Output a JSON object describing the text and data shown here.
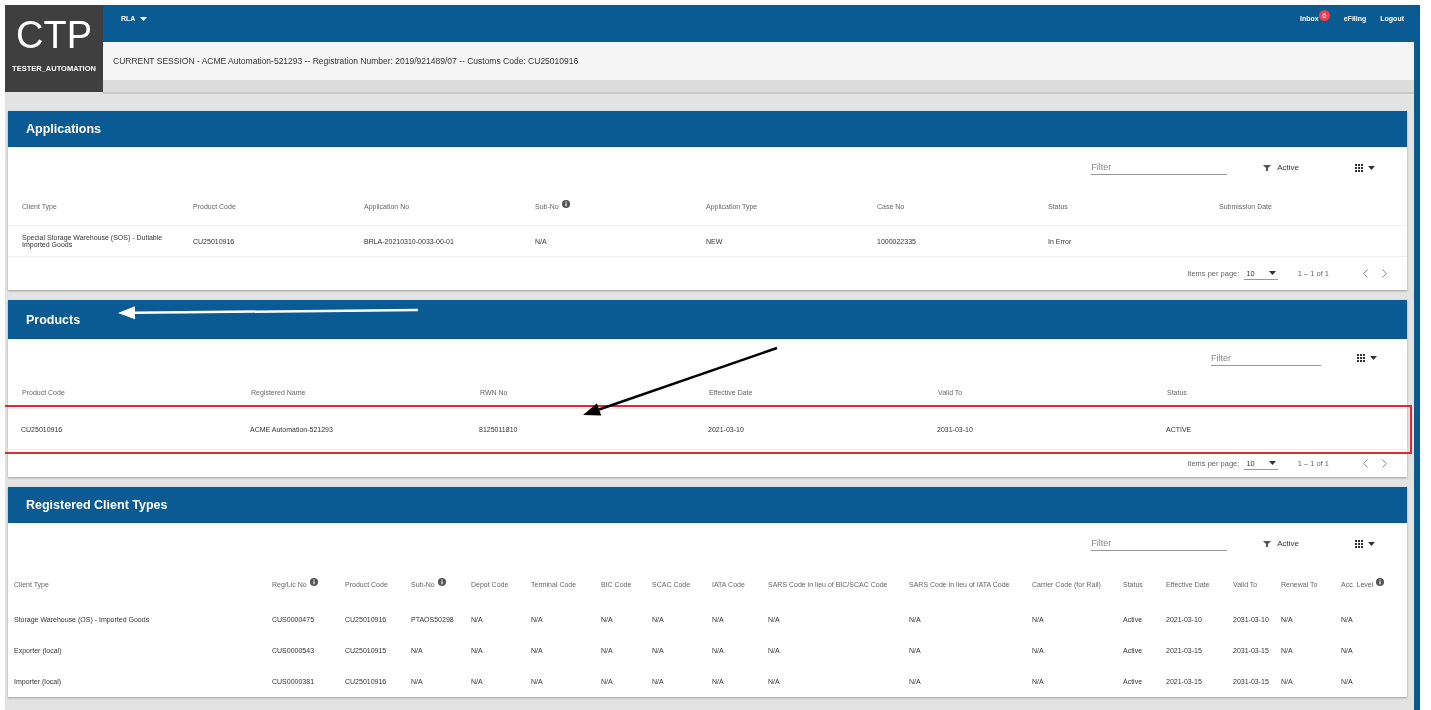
{
  "logo": {
    "title": "CTP",
    "user": "TESTER_AUTOMATION"
  },
  "nav": {
    "menu": "RLA",
    "links": [
      {
        "label": "Inbox",
        "badge": "6"
      },
      {
        "label": "eFiling"
      },
      {
        "label": "Logout"
      }
    ]
  },
  "session": "CURRENT SESSION - ACME Automation-521293 -- Registration Number: 2019/921489/07 -- Customs Code: CU25010916",
  "panels": [
    {
      "title": "Applications",
      "filter": {
        "placeholder": "Filter"
      },
      "status_filter": "Active",
      "columns": [
        {
          "label": "Client Type",
          "info": false
        },
        {
          "label": "Product Code",
          "info": false
        },
        {
          "label": "Application No",
          "info": false
        },
        {
          "label": "Sub-No",
          "info": true
        },
        {
          "label": "Application Type",
          "info": false
        },
        {
          "label": "Case No",
          "info": false
        },
        {
          "label": "Status",
          "info": false
        },
        {
          "label": "Submission Date",
          "info": false
        }
      ],
      "rows": [
        {
          "highlighted": false,
          "cells": [
            "Special Storage Warehouse (SOS) - Dutiable Imported Goods",
            "CU25010916",
            "BRLA-20210310-0033-00-01",
            "N/A",
            "NEW",
            "1000022335",
            "In Error"
          ]
        }
      ],
      "paginator": {
        "label": "Items per page:",
        "page_size": "10",
        "range": "1 – 1 of 1"
      }
    },
    {
      "title": "Products",
      "filter": {
        "placeholder": "Filter"
      },
      "columns": [
        {
          "label": "Product Code",
          "info": false
        },
        {
          "label": "Registered Name",
          "info": false
        },
        {
          "label": "RWN No",
          "info": false
        },
        {
          "label": "Effective Date",
          "info": false
        },
        {
          "label": "Valid To",
          "info": false
        },
        {
          "label": "Status",
          "info": false
        }
      ],
      "rows": [
        {
          "highlighted": true,
          "cells": [
            "CU25010916",
            "ACME Automation-521293",
            "8125011810",
            "2021-03-10",
            "2031-03-10",
            "ACTIVE"
          ]
        }
      ],
      "paginator": {
        "label": "Items per page:",
        "page_size": "10",
        "range": "1 – 1 of 1"
      }
    },
    {
      "title": "Registered Client Types",
      "filter": {
        "placeholder": "Filter"
      },
      "status_filter": "Active",
      "columns": [
        {
          "label": "Client Type",
          "info": false
        },
        {
          "label": "Reg/Lic No",
          "info": true
        },
        {
          "label": "Product Code",
          "info": false
        },
        {
          "label": "Sub-No",
          "info": true
        },
        {
          "label": "Depot Code",
          "info": false
        },
        {
          "label": "Terminal Code",
          "info": false
        },
        {
          "label": "BIC Code",
          "info": false
        },
        {
          "label": "SCAC Code",
          "info": false
        },
        {
          "label": "IATA Code",
          "info": false
        },
        {
          "label": "SARS Code in lieu of BIC/SCAC Code",
          "info": false
        },
        {
          "label": "SARS Code in lieu of IATA Code",
          "info": false
        },
        {
          "label": "Carrier Code (for Rail)",
          "info": false
        },
        {
          "label": "Status",
          "info": false
        },
        {
          "label": "Effective Date",
          "info": false
        },
        {
          "label": "Valid To",
          "info": false
        },
        {
          "label": "Renewal To",
          "info": false
        },
        {
          "label": "Acc. Level",
          "info": true
        }
      ],
      "rows": [
        {
          "highlighted": false,
          "cells": [
            "Storage Warehouse (OS) - Imported Goods",
            "CUS0000475",
            "CU25010916",
            "PTAOS50298",
            "N/A",
            "N/A",
            "N/A",
            "N/A",
            "N/A",
            "N/A",
            "N/A",
            "N/A",
            "Active",
            "2021-03-10",
            "2031-03-10",
            "N/A",
            "N/A"
          ]
        },
        {
          "highlighted": false,
          "cells": [
            "Exporter (local)",
            "CUS0000543",
            "CU25010915",
            "N/A",
            "N/A",
            "N/A",
            "N/A",
            "N/A",
            "N/A",
            "N/A",
            "N/A",
            "N/A",
            "Active",
            "2021-03-15",
            "2031-03-15",
            "N/A",
            "N/A"
          ]
        },
        {
          "highlighted": false,
          "cells": [
            "Importer (local)",
            "CUS0000381",
            "CU25010916",
            "N/A",
            "N/A",
            "N/A",
            "N/A",
            "N/A",
            "N/A",
            "N/A",
            "N/A",
            "N/A",
            "Active",
            "2021-03-15",
            "2031-03-15",
            "N/A",
            "N/A"
          ]
        }
      ]
    }
  ],
  "annotations": [
    {
      "kind": "arrow",
      "color": "#ffffff"
    },
    {
      "kind": "arrow",
      "color": "#000000"
    }
  ]
}
